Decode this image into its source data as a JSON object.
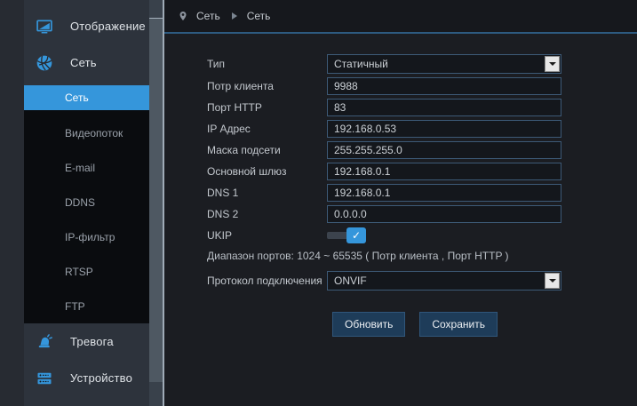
{
  "sidebar": {
    "groups": [
      {
        "label": "Отображение",
        "icon": "monitor-icon"
      },
      {
        "label": "Сеть",
        "icon": "network-icon"
      },
      {
        "label": "Тревога",
        "icon": "alarm-icon"
      },
      {
        "label": "Устройство",
        "icon": "device-icon"
      }
    ],
    "submenu": [
      "Сеть",
      "Видеопоток",
      "E-mail",
      "DDNS",
      "IP-фильтр",
      "RTSP",
      "FTP"
    ],
    "active_item": "Сеть"
  },
  "breadcrumb": {
    "section": "Сеть",
    "page": "Сеть"
  },
  "form": {
    "type": {
      "label": "Тип",
      "value": "Статичный"
    },
    "client_port": {
      "label": "Потр клиента",
      "value": "9988"
    },
    "http_port": {
      "label": "Порт HTTP",
      "value": "83"
    },
    "ip_address": {
      "label": "IP Адрес",
      "value": "192.168.0.53"
    },
    "subnet_mask": {
      "label": "Маска подсети",
      "value": "255.255.255.0"
    },
    "gateway": {
      "label": "Основной шлюз",
      "value": "192.168.0.1"
    },
    "dns1": {
      "label": "DNS 1",
      "value": "192.168.0.1"
    },
    "dns2": {
      "label": "DNS 2",
      "value": "0.0.0.0"
    },
    "ukip": {
      "label": "UKIP",
      "state": "on"
    },
    "port_range_note": "Диапазон портов: 1024 ~ 65535 ( Потр клиента , Порт HTTP )",
    "protocol": {
      "label": "Протокол подключения",
      "value": "ONVIF"
    },
    "buttons": {
      "refresh": "Обновить",
      "save": "Сохранить"
    }
  },
  "colors": {
    "accent": "#3596db",
    "button": "#1e3c59",
    "input_border": "#3d5a77",
    "divider": "#2d5a80"
  }
}
